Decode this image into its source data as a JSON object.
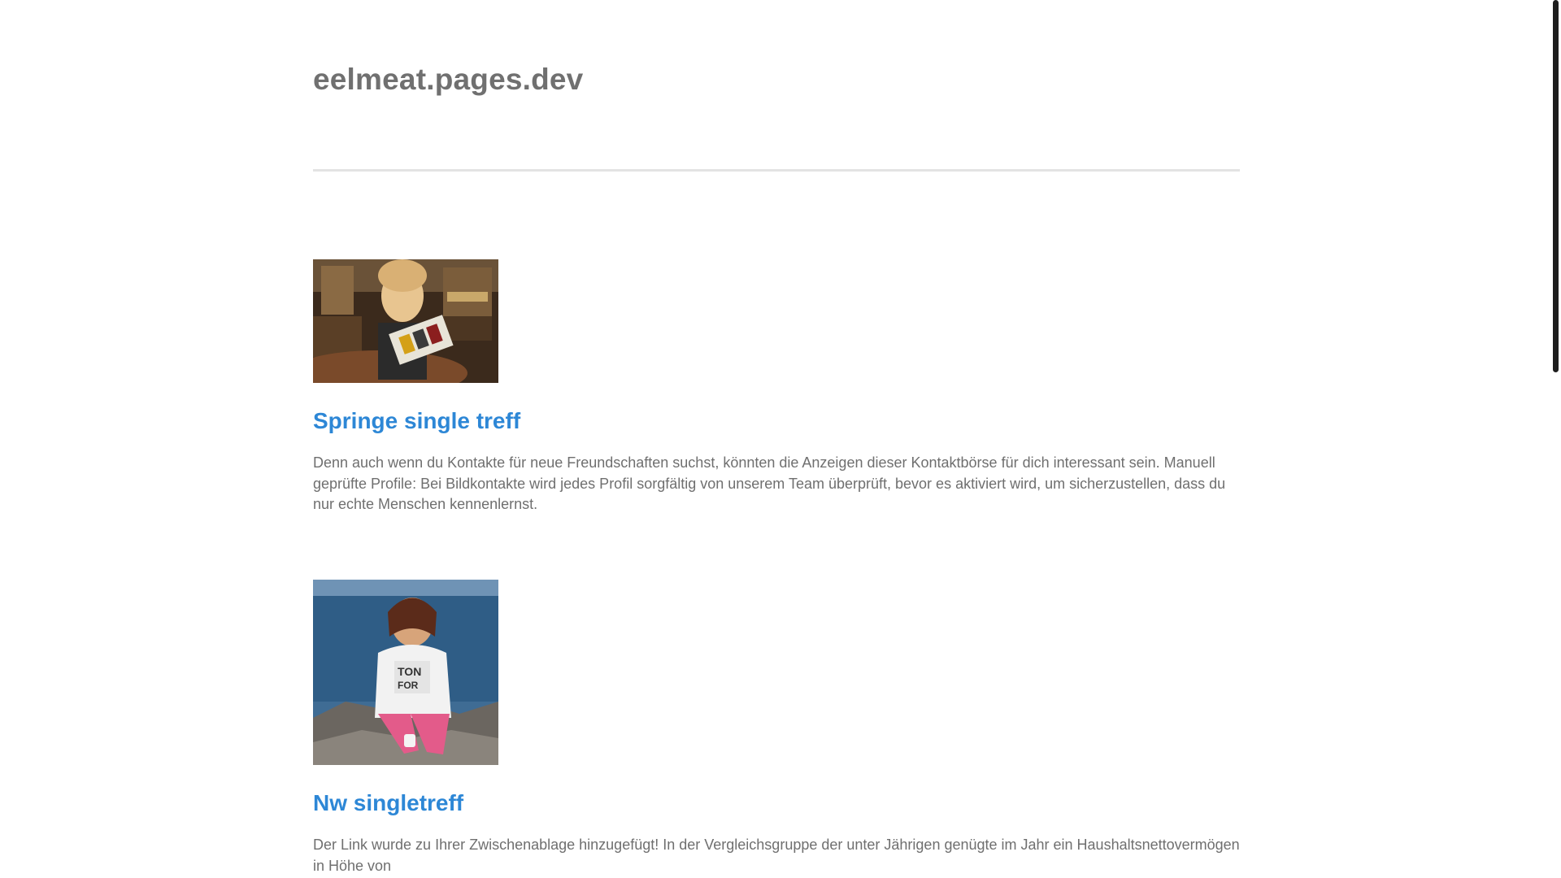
{
  "site": {
    "title": "eelmeat.pages.dev"
  },
  "posts": [
    {
      "title": "Springe single treff",
      "excerpt": "Denn auch wenn du Kontakte für neue Freundschaften suchst, könnten die Anzeigen dieser Kontaktbörse für dich interessant sein. Manuell geprüfte Profile: Bei Bildkontakte wird jedes Profil sorgfältig von unserem Team überprüft, bevor es aktiviert wird, um sicherzustellen, dass du nur echte Menschen kennenlernst.",
      "image": "woman-in-shop-photo"
    },
    {
      "title": "Nw singletreff",
      "excerpt": "Der Link wurde zu Ihrer Zwischenablage hinzugefügt! In der Vergleichsgruppe der unter Jährigen genügte im Jahr ein Haushaltsnettovermögen in Höhe von",
      "image": "woman-by-sea-photo"
    }
  ],
  "colors": {
    "site_title": "#707070",
    "post_title": "#2d87d6",
    "body_text": "#6f6f6f",
    "divider": "#e3e3e3",
    "scrollbar_thumb": "#1e1e1e"
  }
}
